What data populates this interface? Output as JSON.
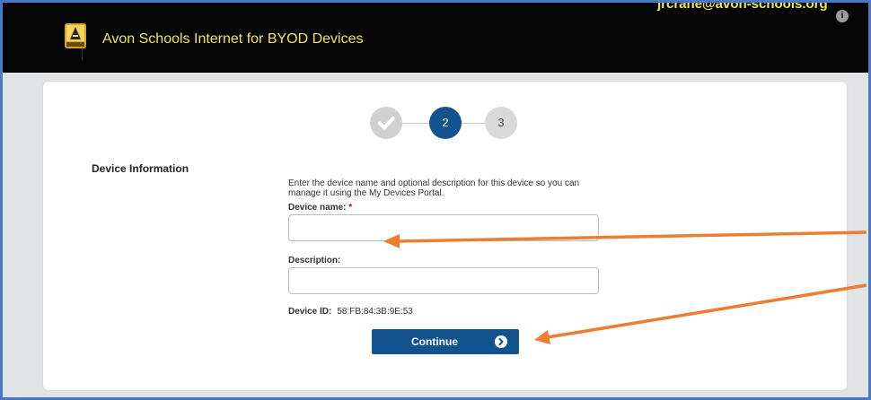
{
  "header": {
    "app_title": "Avon Schools Internet for BYOD Devices",
    "user_email": "jrcrane@avon-schools.org",
    "user_info_icon": "i"
  },
  "stepper": {
    "current_step": 2,
    "steps": [
      {
        "label": "",
        "state": "completed",
        "icon": "check-icon"
      },
      {
        "label": "2",
        "state": "current"
      },
      {
        "label": "3",
        "state": "upcoming"
      }
    ]
  },
  "device_form": {
    "section_title": "Device Information",
    "instructions": "Enter the device name and optional description for this device so you can manage it using the My Devices Portal.",
    "device_name_label": "Device name:",
    "required_mark": "*",
    "device_name_value": "",
    "description_label": "Description:",
    "description_value": "",
    "device_id_label": "Device ID:",
    "device_id_value": "58:FB:84:3B:9E:53",
    "continue_label": "Continue"
  },
  "colors": {
    "header_bg": "#050505",
    "header_text": "#f2e84f",
    "primary_button": "#12538f",
    "page_bg": "#e2e3e5",
    "annotation_arrow": "#ed7d31",
    "frame_border": "#4a78c8"
  }
}
